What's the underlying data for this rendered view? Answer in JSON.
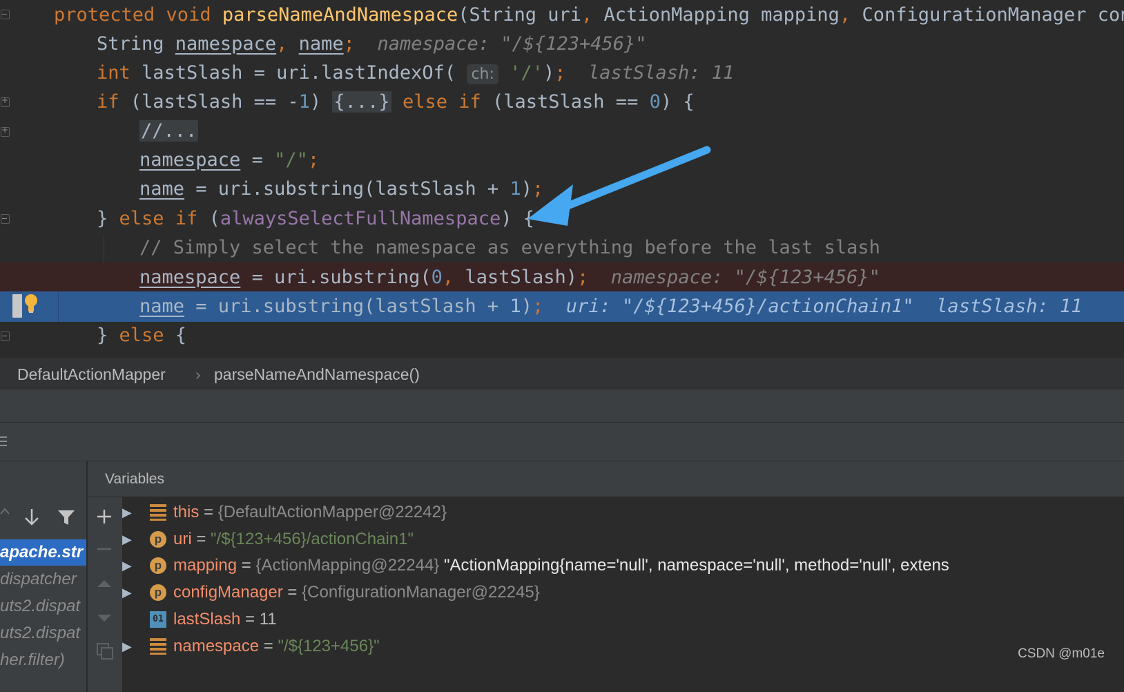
{
  "editor": {
    "lines": [
      {
        "tokens": [
          [
            "kw",
            "protected void "
          ],
          [
            "fn",
            "parseNameAndNamespace"
          ],
          [
            "p",
            "(String uri"
          ],
          [
            "kw",
            ", "
          ],
          [
            "p",
            "ActionMapping mapping"
          ],
          [
            "kw",
            ", "
          ],
          [
            "p",
            "ConfigurationManager conf"
          ]
        ]
      },
      {
        "tokens": [
          [
            "p",
            "String "
          ],
          [
            "u",
            "namespace"
          ],
          [
            "kw",
            ", "
          ],
          [
            "u",
            "name"
          ],
          [
            "kw",
            ";"
          ],
          [
            "p",
            "  "
          ],
          [
            "inl",
            "namespace: \"/${123+456}\""
          ]
        ]
      },
      {
        "tokens": [
          [
            "kw",
            "int "
          ],
          [
            "p",
            "lastSlash = uri.lastIndexOf( "
          ],
          [
            "hint",
            "ch:"
          ],
          [
            "p",
            " "
          ],
          [
            "str",
            "'/'"
          ],
          [
            "p",
            ")"
          ],
          [
            "kw",
            ";"
          ],
          [
            "p",
            "  "
          ],
          [
            "inl",
            "lastSlash: 11"
          ]
        ]
      },
      {
        "tokens": [
          [
            "kw",
            "if "
          ],
          [
            "p",
            "(lastSlash == -"
          ],
          [
            "num",
            "1"
          ],
          [
            "p",
            ") "
          ],
          [
            "fold",
            "{...}"
          ],
          [
            "p",
            " "
          ],
          [
            "kw",
            "else if "
          ],
          [
            "p",
            "(lastSlash == "
          ],
          [
            "num",
            "0"
          ],
          [
            "p",
            ") {"
          ]
        ]
      },
      {
        "tokens": [
          [
            "foldc",
            "//..."
          ]
        ]
      },
      {
        "tokens": [
          [
            "u",
            "namespace"
          ],
          [
            "p",
            " = "
          ],
          [
            "str",
            "\"/\""
          ],
          [
            "kw",
            ";"
          ]
        ]
      },
      {
        "tokens": [
          [
            "u",
            "name"
          ],
          [
            "p",
            " = uri.substring(lastSlash + "
          ],
          [
            "num",
            "1"
          ],
          [
            "p",
            ")"
          ],
          [
            "kw",
            ";"
          ]
        ]
      },
      {
        "tokens": [
          [
            "p",
            "} "
          ],
          [
            "kw",
            "else if "
          ],
          [
            "p",
            "("
          ],
          [
            "fld",
            "alwaysSelectFullNamespace"
          ],
          [
            "p",
            ") {"
          ]
        ]
      },
      {
        "tokens": [
          [
            "cmt",
            "// Simply select the namespace as everything before the last slash"
          ]
        ]
      },
      {
        "tokens": [
          [
            "u",
            "namespace"
          ],
          [
            "p",
            " = uri.substring("
          ],
          [
            "num",
            "0"
          ],
          [
            "kw",
            ", "
          ],
          [
            "p",
            "lastSlash)"
          ],
          [
            "kw",
            ";"
          ],
          [
            "p",
            "  "
          ],
          [
            "inl",
            "namespace: \"/${123+456}\""
          ]
        ]
      },
      {
        "tokens": [
          [
            "u",
            "name"
          ],
          [
            "p",
            " = uri.substring(lastSlash + "
          ],
          [
            "num",
            "1"
          ],
          [
            "p",
            ")"
          ],
          [
            "kw",
            ";"
          ],
          [
            "p",
            "  "
          ],
          [
            "inl",
            "uri: \"/${123+456}/actionChain1\"  lastSlash: 11"
          ]
        ]
      },
      {
        "tokens": [
          [
            "p",
            "} "
          ],
          [
            "kw",
            "else "
          ],
          [
            "p",
            "{"
          ]
        ]
      }
    ]
  },
  "breadcrumb": {
    "class_name": "DefaultActionMapper",
    "separator": "›",
    "method_name": "parseNameAndNamespace()"
  },
  "frames_panel": {
    "frames": [
      "apache.str",
      "dispatcher",
      "uts2.dispat",
      "uts2.dispat",
      "her.filter)"
    ]
  },
  "variables_panel": {
    "title": "Variables",
    "rows": [
      {
        "name": "this",
        "eq": " = ",
        "obj": "{DefaultActionMapper@22242}",
        "value": "",
        "icon": "field-icon",
        "expandable": true
      },
      {
        "name": "uri",
        "eq": " = ",
        "obj": "",
        "value": "\"/${123+456}/actionChain1\"",
        "icon": "p",
        "expandable": true
      },
      {
        "name": "mapping",
        "eq": " = ",
        "obj": "{ActionMapping@22244} ",
        "value": "\"ActionMapping{name='null', namespace='null', method='null', extens",
        "icon": "p",
        "expandable": true
      },
      {
        "name": "configManager",
        "eq": " = ",
        "obj": "{ConfigurationManager@22245}",
        "value": "",
        "icon": "p",
        "expandable": true
      },
      {
        "name": "lastSlash",
        "eq": " = ",
        "obj": "",
        "value": "11",
        "icon": "01",
        "expandable": false
      },
      {
        "name": "namespace",
        "eq": " = ",
        "obj": "",
        "value": "\"/${123+456}\"",
        "icon": "field-icon",
        "expandable": true
      }
    ]
  },
  "watermark": "CSDN @m01e",
  "colors": {
    "keyword": "#cc7832",
    "method": "#ffc66d",
    "string": "#6a8759",
    "number": "#6897bb",
    "field": "#9876aa",
    "breakpoint_line": "#3a2323",
    "execution_line": "#2d5b92",
    "annotation_arrow": "#45a8f0"
  }
}
